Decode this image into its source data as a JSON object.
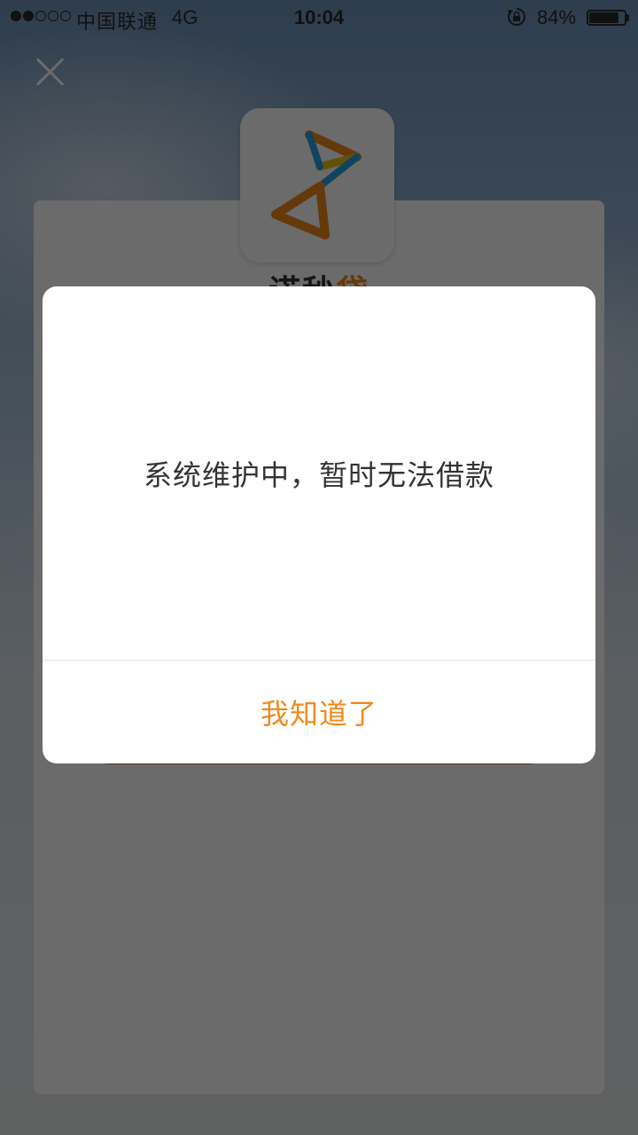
{
  "status_bar": {
    "signal_strength": "2/5",
    "carrier": "中国联通",
    "network": "4G",
    "time": "10:04",
    "battery_percent": "84%",
    "lock_icon": "rotation-lock-icon",
    "battery_level": 0.84
  },
  "background": {
    "close_icon": "close-icon",
    "brand_main": "诺秒",
    "brand_accent": "贷",
    "colors": {
      "accent": "#f08a1c",
      "cta": "#f07a10"
    }
  },
  "dialog": {
    "message": "系统维护中，暂时无法借款",
    "button_label": "我知道了"
  }
}
